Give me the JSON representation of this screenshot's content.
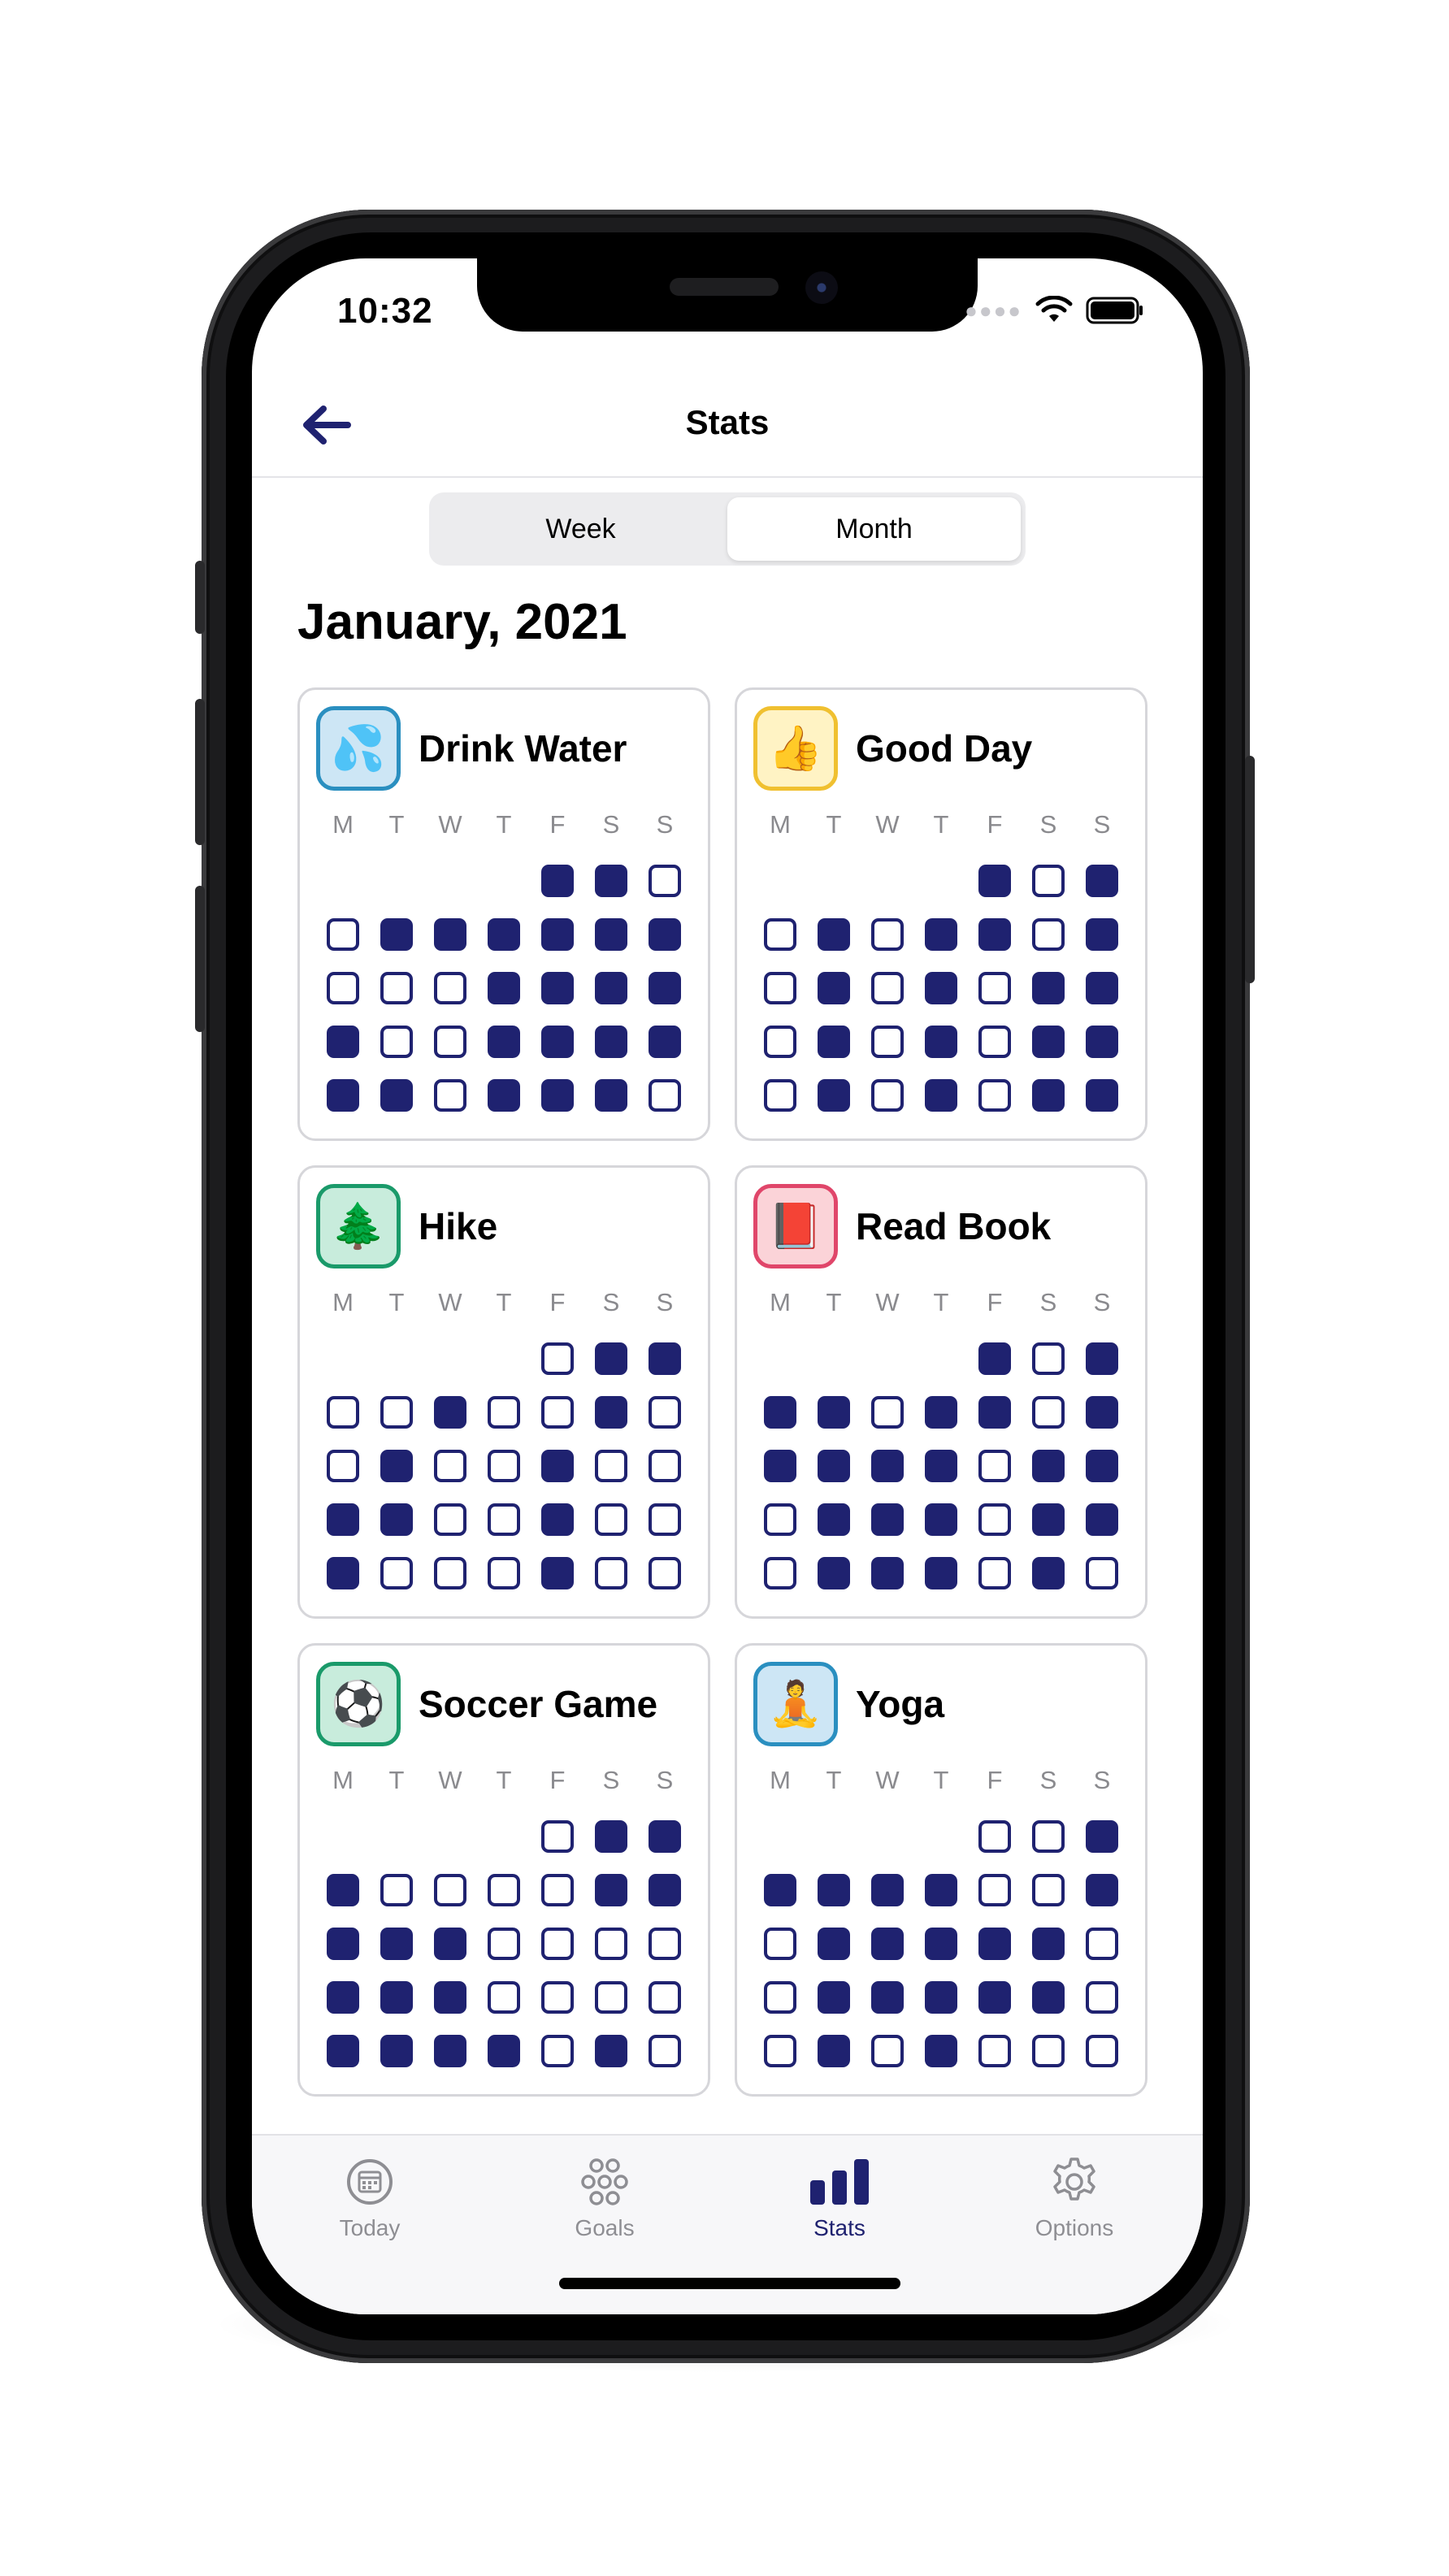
{
  "status": {
    "time": "10:32"
  },
  "nav": {
    "title": "Stats",
    "back_icon": "arrow-left-icon"
  },
  "segments": {
    "week": "Week",
    "month": "Month",
    "selected": "Month"
  },
  "month_title": "January, 2021",
  "day_labels": [
    "M",
    "T",
    "W",
    "T",
    "F",
    "S",
    "S"
  ],
  "colors": {
    "accent": "#1f2270",
    "card_border": "#d6d6da"
  },
  "habits": [
    {
      "name": "Drink Water",
      "emoji": "💦",
      "icon_bg": "#cde6f5",
      "icon_border": "#2a8fc0",
      "cells": [
        [
          null,
          null,
          null,
          null,
          1,
          1,
          0
        ],
        [
          0,
          1,
          1,
          1,
          1,
          1,
          1
        ],
        [
          0,
          0,
          0,
          1,
          1,
          1,
          1
        ],
        [
          1,
          0,
          0,
          1,
          1,
          1,
          1
        ],
        [
          1,
          1,
          0,
          1,
          1,
          1,
          0
        ]
      ]
    },
    {
      "name": "Good Day",
      "emoji": "👍",
      "icon_bg": "#fff3c4",
      "icon_border": "#f0c030",
      "cells": [
        [
          null,
          null,
          null,
          null,
          1,
          0,
          1
        ],
        [
          0,
          1,
          0,
          1,
          1,
          0,
          1
        ],
        [
          0,
          1,
          0,
          1,
          0,
          1,
          1
        ],
        [
          0,
          1,
          0,
          1,
          0,
          1,
          1
        ],
        [
          0,
          1,
          0,
          1,
          0,
          1,
          1
        ]
      ]
    },
    {
      "name": "Hike",
      "emoji": "🌲",
      "icon_bg": "#c8ecdc",
      "icon_border": "#1a9a6a",
      "cells": [
        [
          null,
          null,
          null,
          null,
          0,
          1,
          1
        ],
        [
          0,
          0,
          1,
          0,
          0,
          1,
          0
        ],
        [
          0,
          1,
          0,
          0,
          1,
          0,
          0
        ],
        [
          1,
          1,
          0,
          0,
          1,
          0,
          0
        ],
        [
          1,
          0,
          0,
          0,
          1,
          0,
          0
        ]
      ]
    },
    {
      "name": "Read Book",
      "emoji": "📕",
      "icon_bg": "#fbd3d8",
      "icon_border": "#e0466a",
      "cells": [
        [
          null,
          null,
          null,
          null,
          1,
          0,
          1
        ],
        [
          1,
          1,
          0,
          1,
          1,
          0,
          1
        ],
        [
          1,
          1,
          1,
          1,
          0,
          1,
          1
        ],
        [
          0,
          1,
          1,
          1,
          0,
          1,
          1
        ],
        [
          0,
          1,
          1,
          1,
          0,
          1,
          0
        ]
      ]
    },
    {
      "name": "Soccer Game",
      "emoji": "⚽",
      "icon_bg": "#c8ecdc",
      "icon_border": "#1a9a6a",
      "cells": [
        [
          null,
          null,
          null,
          null,
          0,
          1,
          1
        ],
        [
          1,
          0,
          0,
          0,
          0,
          1,
          1
        ],
        [
          1,
          1,
          1,
          0,
          0,
          0,
          0
        ],
        [
          1,
          1,
          1,
          0,
          0,
          0,
          0
        ],
        [
          1,
          1,
          1,
          1,
          0,
          1,
          0
        ]
      ]
    },
    {
      "name": "Yoga",
      "emoji": "🧘",
      "icon_bg": "#cde6f5",
      "icon_border": "#2a8fc0",
      "cells": [
        [
          null,
          null,
          null,
          null,
          0,
          0,
          1
        ],
        [
          1,
          1,
          1,
          1,
          0,
          0,
          1
        ],
        [
          0,
          1,
          1,
          1,
          1,
          1,
          0
        ],
        [
          0,
          1,
          1,
          1,
          1,
          1,
          0
        ],
        [
          0,
          1,
          0,
          1,
          0,
          0,
          0
        ]
      ]
    }
  ],
  "tabs": [
    {
      "label": "Today",
      "icon": "calendar-icon"
    },
    {
      "label": "Goals",
      "icon": "flower-grid-icon"
    },
    {
      "label": "Stats",
      "icon": "bar-chart-icon",
      "active": true
    },
    {
      "label": "Options",
      "icon": "gear-icon"
    }
  ]
}
